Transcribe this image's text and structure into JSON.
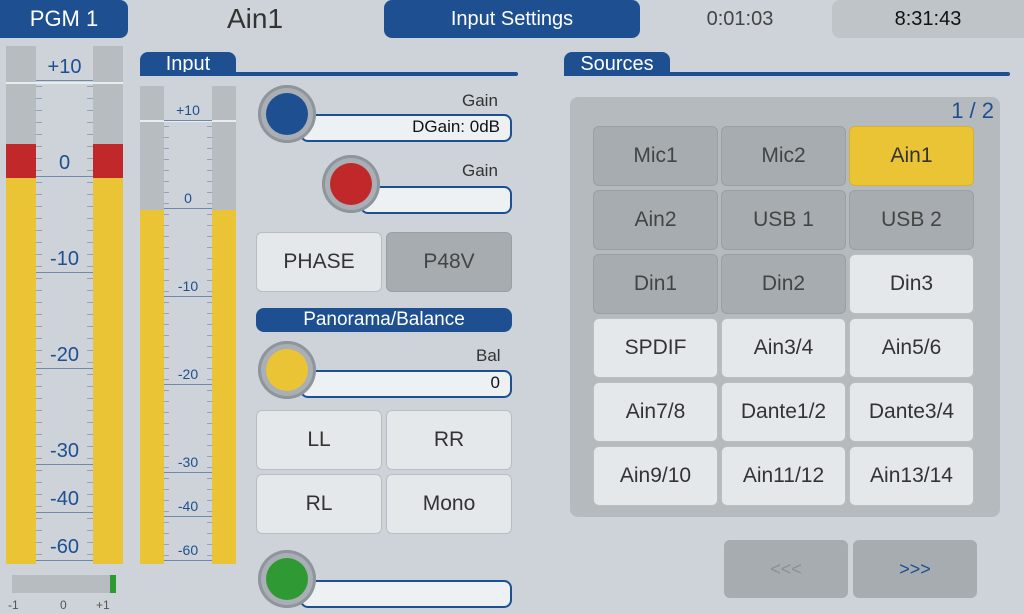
{
  "header": {
    "program": "PGM 1",
    "channel": "Ain1",
    "settings_button": "Input Settings",
    "elapsed": "0:01:03",
    "clock": "8:31:43"
  },
  "left_meter": {
    "scale": [
      "+10",
      "0",
      "-10",
      "-20",
      "-30",
      "-40",
      "-60"
    ],
    "balance_scale": [
      "-1",
      "0",
      "+1"
    ],
    "balance_value": 1
  },
  "input": {
    "title": "Input",
    "meter_scale": [
      "+10",
      "0",
      "-10",
      "-20",
      "-30",
      "-40",
      "-60"
    ],
    "gain1_label": "Gain",
    "gain1_value": "DGain: 0dB",
    "gain2_label": "Gain",
    "gain2_value": "",
    "phase_label": "PHASE",
    "p48v_label": "P48V",
    "panorama_title": "Panorama/Balance",
    "bal_label": "Bal",
    "bal_value": "0",
    "pan_buttons": [
      "LL",
      "RR",
      "RL",
      "Mono"
    ],
    "bottom_value": ""
  },
  "sources": {
    "title": "Sources",
    "page": "1 / 2",
    "buttons": [
      {
        "label": "Mic1",
        "state": "dark"
      },
      {
        "label": "Mic2",
        "state": "dark"
      },
      {
        "label": "Ain1",
        "state": "on"
      },
      {
        "label": "Ain2",
        "state": "dark"
      },
      {
        "label": "USB 1",
        "state": "dark"
      },
      {
        "label": "USB 2",
        "state": "dark"
      },
      {
        "label": "Din1",
        "state": "dark"
      },
      {
        "label": "Din2",
        "state": "dark"
      },
      {
        "label": "Din3",
        "state": "light"
      },
      {
        "label": "SPDIF",
        "state": "light"
      },
      {
        "label": "Ain3/4",
        "state": "light"
      },
      {
        "label": "Ain5/6",
        "state": "light"
      },
      {
        "label": "Ain7/8",
        "state": "light"
      },
      {
        "label": "Dante1/2",
        "state": "light"
      },
      {
        "label": "Dante3/4",
        "state": "light"
      },
      {
        "label": "Ain9/10",
        "state": "light"
      },
      {
        "label": "Ain11/12",
        "state": "light"
      },
      {
        "label": "Ain13/14",
        "state": "light"
      }
    ],
    "prev_label": "<<<",
    "next_label": ">>>"
  },
  "colors": {
    "accent": "#1d4f91",
    "active": "#ebc436",
    "clip": "#c0282a",
    "knob_gain1": "#1d4f91",
    "knob_gain2": "#c0282a",
    "knob_bal": "#ebc436",
    "knob_bottom": "#2f9a34"
  }
}
